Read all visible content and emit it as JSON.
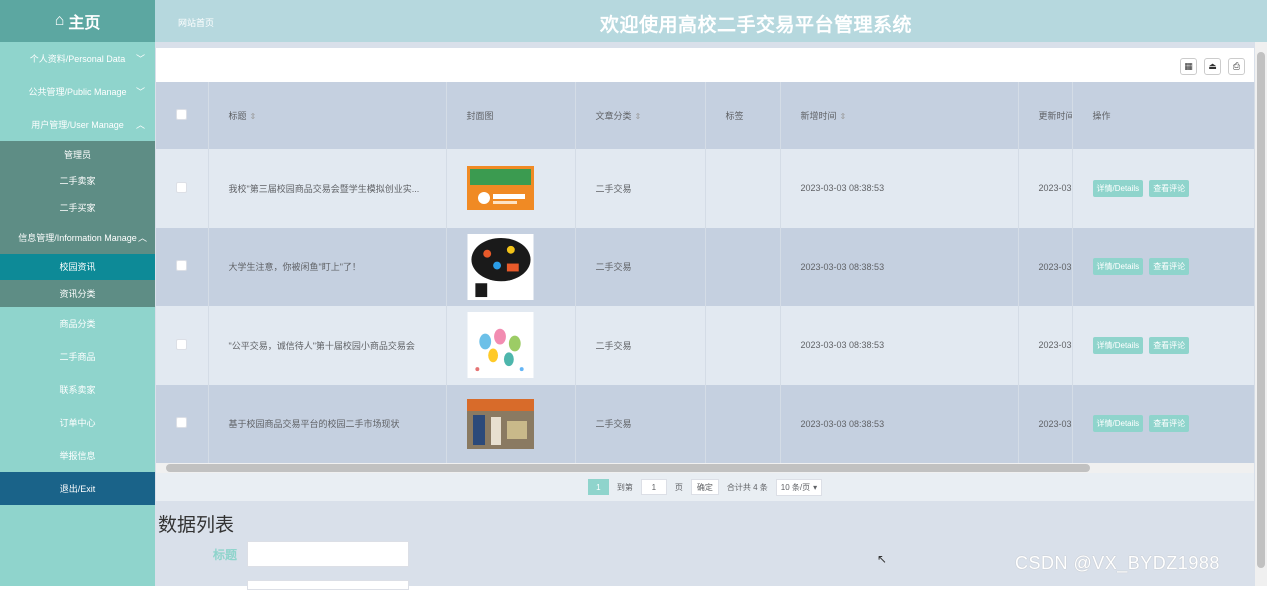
{
  "header": {
    "home_label": "主页",
    "breadcrumb": "网站首页",
    "system_title": "欢迎使用高校二手交易平台管理系统"
  },
  "sidebar": {
    "groups": [
      {
        "label": "个人资料/Personal Data"
      },
      {
        "label": "公共管理/Public Manage"
      },
      {
        "label": "用户管理/User Manage"
      },
      {
        "label": "信息管理/Information Manage"
      }
    ],
    "user_items": [
      "管理员",
      "二手卖家",
      "二手买家"
    ],
    "info_items": [
      "校园资讯",
      "资讯分类"
    ],
    "plain_items": [
      "商品分类",
      "二手商品",
      "联系卖家",
      "订单中心",
      "举报信息"
    ],
    "exit_label": "退出/Exit"
  },
  "table": {
    "headers": [
      "标题",
      "封面图",
      "文章分类",
      "标签",
      "新增时间",
      "更新时间",
      "操作"
    ],
    "rows": [
      {
        "title": "我校\"第三届校园商品交易会暨学生模拟创业实...",
        "category": "二手交易",
        "tag": "",
        "created": "2023-03-03 08:38:53",
        "updated": "2023-03"
      },
      {
        "title": "大学生注意，你被闲鱼\"盯上\"了！",
        "category": "二手交易",
        "tag": "",
        "created": "2023-03-03 08:38:53",
        "updated": "2023-03"
      },
      {
        "title": "\"公平交易，诚信待人\"第十届校园小商品交易会",
        "category": "二手交易",
        "tag": "",
        "created": "2023-03-03 08:38:53",
        "updated": "2023-03"
      },
      {
        "title": "基于校园商品交易平台的校园二手市场现状",
        "category": "二手交易",
        "tag": "",
        "created": "2023-03-03 08:38:53",
        "updated": "2023-03"
      }
    ],
    "detail_label": "详情/Details",
    "comment_label": "查看评论"
  },
  "pager": {
    "current": "1",
    "goto_label": "到第",
    "goto_value": "1",
    "page_unit": "页",
    "confirm_label": "确定",
    "total_label": "合计共 4 条",
    "page_size": "10 条/页"
  },
  "form": {
    "title": "数据列表",
    "title_field_label": "标题"
  },
  "watermark": "CSDN @VX_BYDZ1988",
  "colors": {
    "accent": "#8fd4cc",
    "header_bg": "#b6d8de",
    "sidebar_bg": "#8fd4cc",
    "active_item": "#0d8a97",
    "exit_bg": "#1a6389"
  }
}
